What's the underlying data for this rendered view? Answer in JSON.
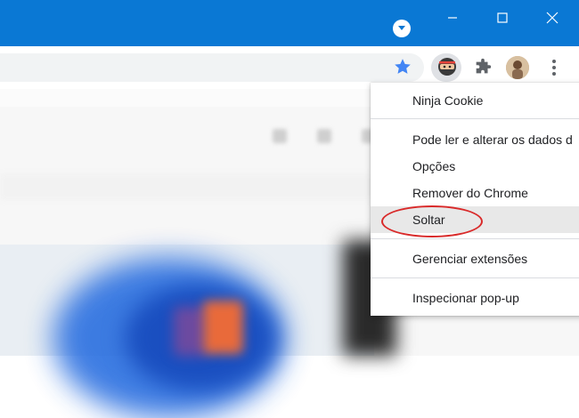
{
  "window": {
    "minimize_icon": "minimize-icon",
    "maximize_icon": "maximize-icon",
    "close_icon": "close-icon",
    "profile_dropdown_icon": "chevron-down-circle-icon",
    "titlebar_color": "#0a78d4"
  },
  "toolbar": {
    "bookmark_icon": "star-icon",
    "bookmark_color": "#4285f4",
    "active_extension_icon": "ninja-cookie-icon",
    "extensions_icon": "puzzle-icon",
    "profile_icon": "avatar",
    "menu_icon": "kebab-menu-icon"
  },
  "context_menu": {
    "title": "Ninja Cookie",
    "permission": "Pode ler e alterar os dados d",
    "options": "Opções",
    "remove": "Remover do Chrome",
    "unpin": "Soltar",
    "manage": "Gerenciar extensões",
    "inspect": "Inspecionar pop-up",
    "highlighted_item": "Soltar",
    "annotation_color": "#d92a2a"
  }
}
